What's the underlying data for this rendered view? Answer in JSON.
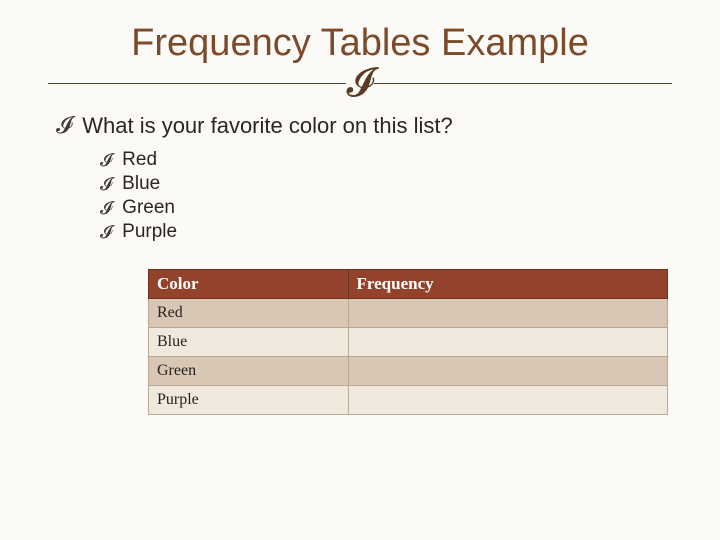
{
  "title": "Frequency Tables Example",
  "question": "What is your favorite color on this list?",
  "options": [
    "Red",
    "Blue",
    "Green",
    "Purple"
  ],
  "table": {
    "headers": {
      "col1": "Color",
      "col2": "Frequency"
    },
    "rows": [
      {
        "color": "Red",
        "frequency": ""
      },
      {
        "color": "Blue",
        "frequency": ""
      },
      {
        "color": "Green",
        "frequency": ""
      },
      {
        "color": "Purple",
        "frequency": ""
      }
    ]
  },
  "chart_data": {
    "type": "table",
    "title": "Frequency Tables Example",
    "columns": [
      "Color",
      "Frequency"
    ],
    "rows": [
      [
        "Red",
        null
      ],
      [
        "Blue",
        null
      ],
      [
        "Green",
        null
      ],
      [
        "Purple",
        null
      ]
    ]
  }
}
